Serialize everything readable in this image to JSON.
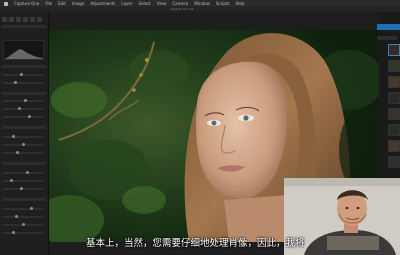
{
  "menubar": {
    "items": [
      "Capture One",
      "File",
      "Edit",
      "Image",
      "Adjustments",
      "Layer",
      "Select",
      "View",
      "Camera",
      "Window",
      "Scripts",
      "Help"
    ]
  },
  "window": {
    "title": "Capture One 21"
  },
  "subtitle": {
    "text": "基本上，当然，您需要仔细地处理肖像，因此，我将"
  },
  "icons": {
    "apple": "apple-icon",
    "histogram": "histogram-icon"
  },
  "colors": {
    "accent": "#1d6fb8",
    "background": "#1e1e1e"
  }
}
